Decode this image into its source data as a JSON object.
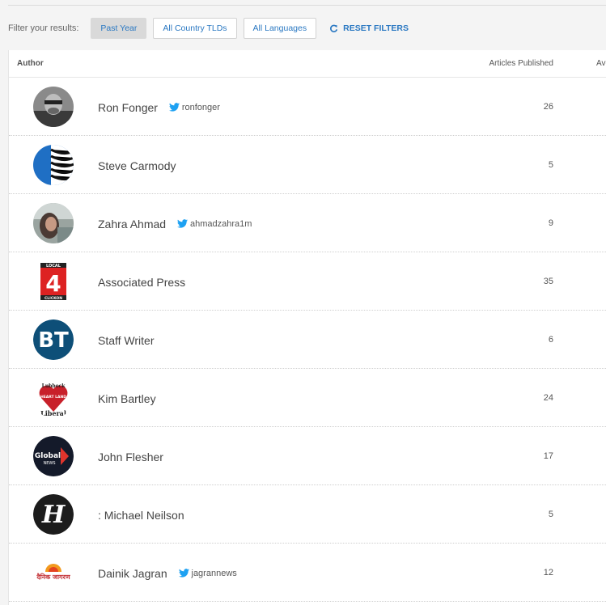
{
  "filters": {
    "label": "Filter your results:",
    "buttons": [
      "Past Year",
      "All Country TLDs",
      "All Languages"
    ],
    "reset": "RESET FILTERS"
  },
  "table": {
    "headers": {
      "author": "Author",
      "articles": "Articles Published",
      "avg": "Avg"
    },
    "rows": [
      {
        "name": "Ron Fonger",
        "twitter": "ronfonger",
        "count": "26"
      },
      {
        "name": "Steve Carmody",
        "twitter": "",
        "count": "5"
      },
      {
        "name": "Zahra Ahmad",
        "twitter": "ahmadzahra1m",
        "count": "9"
      },
      {
        "name": "Associated Press",
        "twitter": "",
        "count": "35",
        "logo_text": "4",
        "logo_top": "LOCAL",
        "logo_bottom": "CLICKON"
      },
      {
        "name": "Staff Writer",
        "twitter": "",
        "count": "6",
        "logo_text": "BT"
      },
      {
        "name": "Kim Bartley",
        "twitter": "",
        "count": "24",
        "logo_top": "Lubbock",
        "logo_mid": "HEART LAND",
        "logo_bottom": "Liberal"
      },
      {
        "name": "John Flesher",
        "twitter": "",
        "count": "17",
        "logo_text": "Global",
        "logo_sub": "NEWS"
      },
      {
        "name": ": Michael Neilson",
        "twitter": "",
        "count": "5",
        "logo_text": "H"
      },
      {
        "name": "Dainik Jagran",
        "twitter": "jagrannews",
        "count": "12",
        "logo_text": "दैनिक जागरण"
      }
    ]
  },
  "colors": {
    "link": "#2a78c2",
    "twitter": "#1da1f2"
  }
}
